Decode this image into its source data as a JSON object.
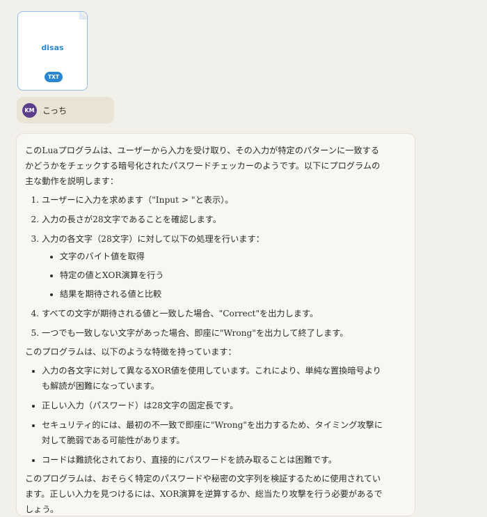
{
  "attachment": {
    "name": "disas",
    "type_badge": "TXT"
  },
  "user": {
    "initials": "KM",
    "message": "こっち"
  },
  "response": {
    "intro": "このLuaプログラムは、ユーザーから入力を受け取り、その入力が特定のパターンに一致するかどうかをチェックする暗号化されたパスワードチェッカーのようです。以下にプログラムの主な動作を説明します：",
    "steps": [
      "ユーザーに入力を求めます（\"Input > \"と表示）。",
      "入力の長さが28文字であることを確認します。",
      "入力の各文字（28文字）に対して以下の処理を行います：",
      "すべての文字が期待される値と一致した場合、\"Correct\"を出力します。",
      "一つでも一致しない文字があった場合、即座に\"Wrong\"を出力して終了します。"
    ],
    "substeps": [
      "文字のバイト値を取得",
      "特定の値とXOR演算を行う",
      "結果を期待される値と比較"
    ],
    "features_intro": "このプログラムは、以下のような特徴を持っています：",
    "features": [
      "入力の各文字に対して異なるXOR値を使用しています。これにより、単純な置換暗号よりも解読が困難になっています。",
      "正しい入力（パスワード）は28文字の固定長です。",
      "セキュリティ的には、最初の不一致で即座に\"Wrong\"を出力するため、タイミング攻撃に対して脆弱である可能性があります。",
      "コードは難読化されており、直接的にパスワードを読み取ることは困難です。"
    ],
    "conclusion": "このプログラムは、おそらく特定のパスワードや秘密の文字列を検証するために使用されています。正しい入力を見つけるには、XOR演算を逆算するか、総当たり攻撃を行う必要があるでしょう。"
  }
}
